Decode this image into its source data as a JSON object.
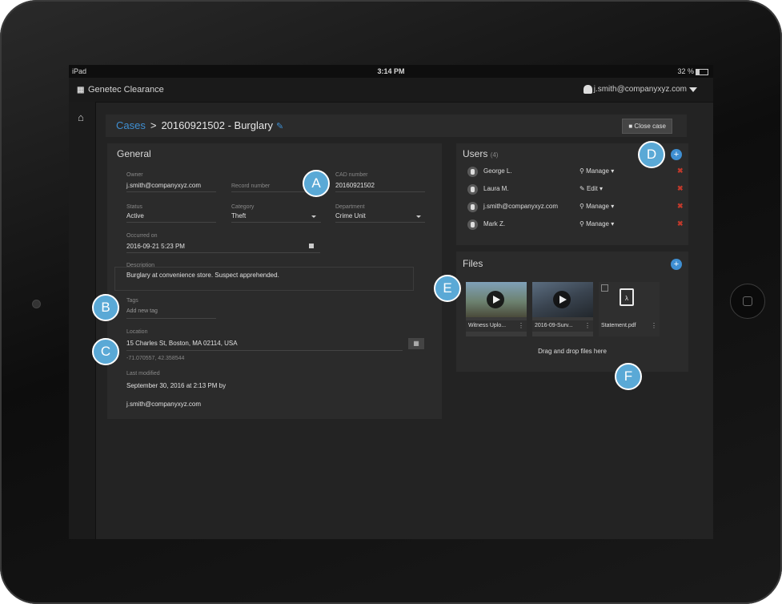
{
  "status_bar": {
    "device": "iPad",
    "time": "3:14 PM",
    "battery": "32 %"
  },
  "app": {
    "title": "Genetec Clearance",
    "user_email": "j.smith@companyxyz.com"
  },
  "case": {
    "breadcrumb_root": "Cases",
    "separator": ">",
    "title": "20160921502 - Burglary",
    "close_label": "Close case"
  },
  "general": {
    "heading": "General",
    "owner_label": "Owner",
    "owner_value": "j.smith@companyxyz.com",
    "record_label": "Record number",
    "cad_label": "CAD number",
    "cad_value": "20160921502",
    "status_label": "Status",
    "status_value": "Active",
    "category_label": "Category",
    "category_value": "Theft",
    "department_label": "Department",
    "department_value": "Crime Unit",
    "occurred_label": "Occurred on",
    "occurred_value": "2016-09-21 5:23 PM",
    "description_label": "Description",
    "description_value": "Burglary at convenience store. Suspect apprehended.",
    "tags_label": "Tags",
    "tags_placeholder": "Add new tag",
    "location_label": "Location",
    "location_value": "15 Charles St, Boston, MA 02114, USA",
    "coordinates": "-71.070557, 42.358544",
    "modified_label": "Last modified",
    "modified_value": "September 30, 2016 at 2:13 PM by",
    "modified_by": "j.smith@companyxyz.com"
  },
  "users": {
    "heading": "Users",
    "count": "(4)",
    "items": [
      {
        "name": "George L.",
        "role": "Manage"
      },
      {
        "name": "Laura M.",
        "role": "Edit"
      },
      {
        "name": "j.smith@companyxyz.com",
        "role": "Manage"
      },
      {
        "name": "Mark Z.",
        "role": "Manage"
      }
    ]
  },
  "files": {
    "heading": "Files",
    "items": [
      {
        "name": "Witness Uplo...",
        "type": "video"
      },
      {
        "name": "2016-09-Surv...",
        "type": "video"
      },
      {
        "name": "Statement.pdf",
        "type": "pdf"
      }
    ],
    "drop_hint": "Drag and drop files here"
  },
  "callouts": [
    "A",
    "B",
    "C",
    "D",
    "E",
    "F"
  ],
  "colors": {
    "accent": "#3f8fd2",
    "callout": "#5aa9d6",
    "remove": "#c0392b",
    "panel": "#2b2b2b",
    "background": "#232323"
  }
}
